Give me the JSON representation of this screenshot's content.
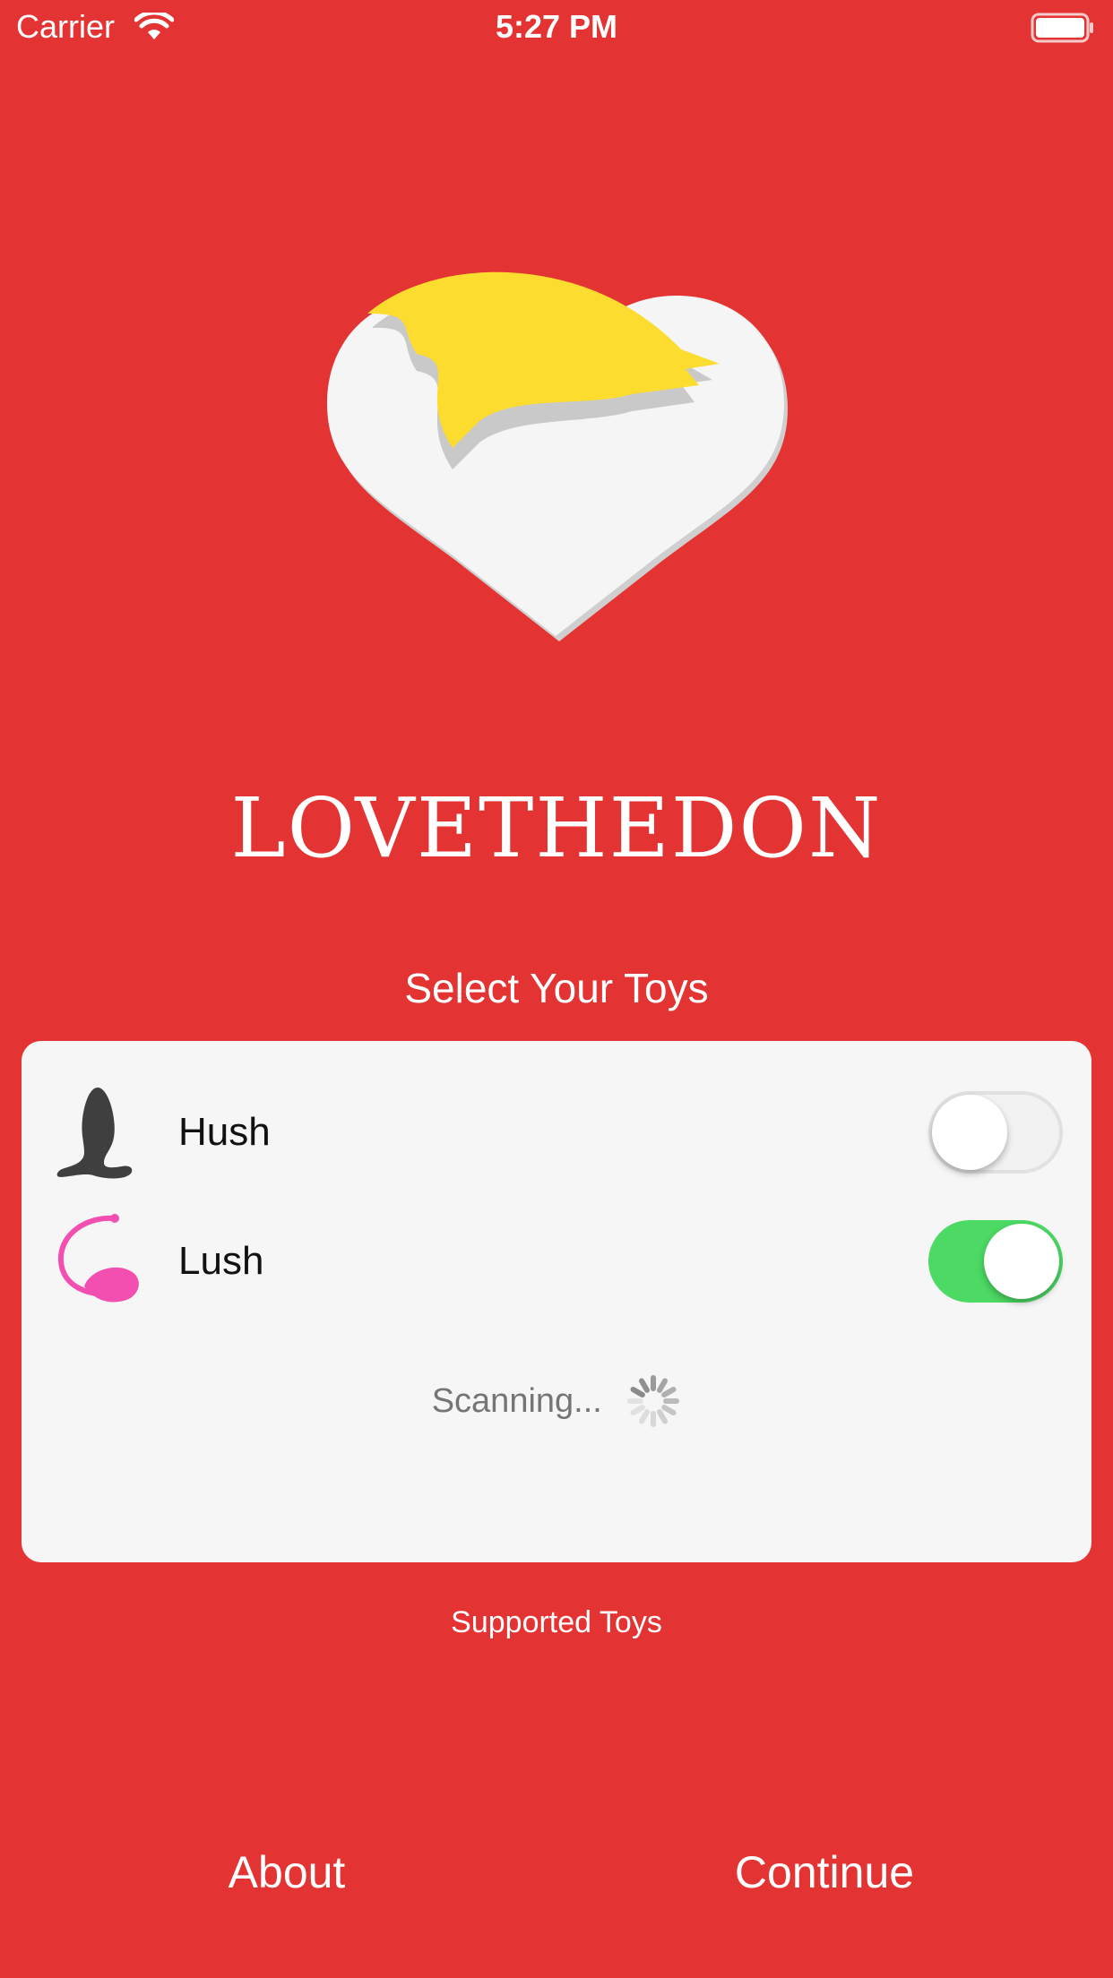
{
  "status_bar": {
    "carrier": "Carrier",
    "time": "5:27 PM",
    "wifi_icon": "wifi-icon",
    "battery_icon": "battery-icon"
  },
  "app": {
    "name": "LOVETHEDON",
    "logo_icon": "heart-with-hair-logo",
    "background_color": "#e43333"
  },
  "main": {
    "title": "Select Your Toys",
    "toys": [
      {
        "label": "Hush",
        "icon": "hush-toy-icon",
        "enabled": false
      },
      {
        "label": "Lush",
        "icon": "lush-toy-icon",
        "enabled": true
      }
    ],
    "scanning_text": "Scanning...",
    "supported_link": "Supported Toys"
  },
  "footer": {
    "about_label": "About",
    "continue_label": "Continue"
  },
  "colors": {
    "switch_on": "#4cd964",
    "panel": "#f6f6f6",
    "hair": "#fcdd2f",
    "lush_pink": "#f24fb1"
  }
}
